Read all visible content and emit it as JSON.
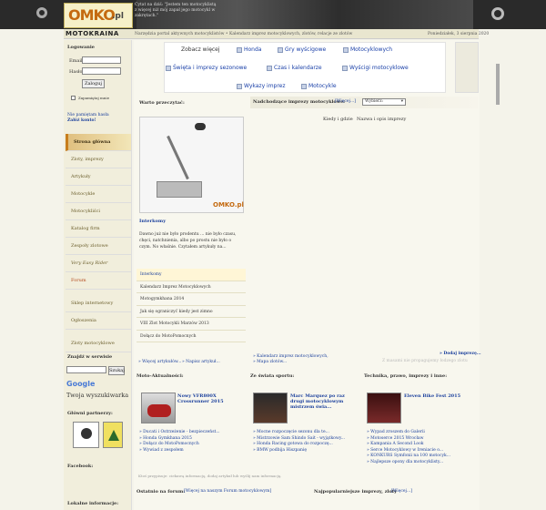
{
  "header": {
    "logo_main": "OMKO",
    "logo_suffix": ".pl",
    "tagline": "Cytat na dziś: \"Jestem ten motocyklistą z więcej niż mój zapał jego motocykl w zakrętach.\"",
    "brand": "MOTOKRAINA",
    "marquee": "Narzędzia portal aktywnych motocyklistów • Kalendarz imprez motocyklowych, zlotów, relacje ze zlotów",
    "date": "Poniedziałek, 3 sierpnia 2020"
  },
  "login": {
    "title": "Logowanie",
    "email_label": "Email:",
    "pass_label": "Hasło:",
    "email_value": "",
    "pass_value": "",
    "button": "Zaloguj",
    "remember": "Zapamiętaj mnie",
    "help1": "Nie pamiętam hasła",
    "help2": "Załóż konto!"
  },
  "nav": {
    "items": [
      "Strona główna",
      "Zloty, imprezy",
      "Artykuły",
      "Motocykle",
      "Motocykliści",
      "Katalog firm",
      "Zespoły zlotowe",
      "Very Easy Rider",
      "Forum",
      "Sklep internetowy",
      "Ogłoszenia",
      "Zloty motocyklowe"
    ]
  },
  "search": {
    "title": "Znajdź w serwisie",
    "input": "",
    "button": "Szukaj",
    "google": "Google",
    "google_text": "Twoja wyszukiwarka"
  },
  "partners": {
    "title": "Główni partnerzy:",
    "facebook": "Facebook:",
    "info": "Lokalne informacje:"
  },
  "ads": {
    "title": "Zobacz więcej",
    "links": [
      "Honda",
      "Gry wyścigowe",
      "Motocyklowych",
      "Święta i imprezy sezonowe",
      "Czas i kalendarze",
      "Wyścigi motocyklowe",
      "Wykazy imprez",
      "Motocykle"
    ]
  },
  "warto": {
    "title": "Warto przeczytać:",
    "logo": "OMKO.pl",
    "article_title": "Interkomy",
    "article_text": "Dawno już nie było prodentu ... nie było czasu, chęci, natchnienia, albo po prostu nie było o czym. No właśnie. Czytałem artykuły na...",
    "links": [
      "Interkomy",
      "Kalendarz Imprez Motocyklowych",
      "Motogymkhana 2014",
      "Jak się ograniczyć kiedy jest zimno",
      "VIII Zlot Motocykli Marzów 2013",
      "Dołącz do MotoPomocnych"
    ],
    "more": "» Więcej artykułów...",
    "write": "» Napisz artykuł..."
  },
  "events": {
    "title": "Nadchodzące imprezy motocyklowe:",
    "more_link": "[Więcej...]",
    "select": "Wybierz:",
    "col1": "Kiedy i gdzie",
    "col2": "Nazwa i opis imprezy",
    "foot1": "» Kalendarz imprez motocyklowych,",
    "foot2": "» Mapa zlotów...",
    "add": "» Dodaj imprezę...",
    "note": "Z masami nie propagujemy łodzego zlotu"
  },
  "news": [
    {
      "title": "Moto-Aktualności:",
      "headline": "Nowy VFR800X Crossrunner 2015",
      "items": [
        "» Ducati i Ostrzeżenie - bezpieczeńst...",
        "» Honda Gymkhana 2015",
        "» Dołącz do MotoPomocnych",
        "» Wywiad z zespołem"
      ]
    },
    {
      "title": "Ze świata sportu:",
      "headline": "Marc Marquez po raz drugi motocyklowym mistrzem świa...",
      "items": [
        "» Mocne rozpoczęcie sezonu dla te...",
        "» Mistrzowie Sam Shindo Sait - wyjątkowy...",
        "» Honda Racing gotowa do rozpoczę...",
        "» BMW podbija Hiszpanię"
      ]
    },
    {
      "title": "Technika, prawo, imprezy i inne:",
      "headline": "Eleven Bike Fest 2015",
      "items": [
        "» Wypad zroszem do Galerii",
        "» Motoserce 2015 Wrocław",
        "» Kampania A Second Look",
        "» Serce Motocyklowy w Ireniacie o...",
        "» KONKURS Symfonii na 100 motocyk...",
        "» Najlepsze opony dla motocyklisty..."
      ]
    }
  ],
  "news_foot": "Ktoś przypisuje: ciekawą informację, dodaj artykuł lub wyślij nam informację.",
  "bottom": {
    "forum": "Ostatnio na forum:",
    "forum_link": "[Więcej na naszym Forum motocyklowym]",
    "popular": "Najpopularniejsze imprezy, zloty",
    "popular_link": "[Więcej...]"
  },
  "colors": {
    "accent": "#c77d1c",
    "link": "#1a3f9c"
  }
}
